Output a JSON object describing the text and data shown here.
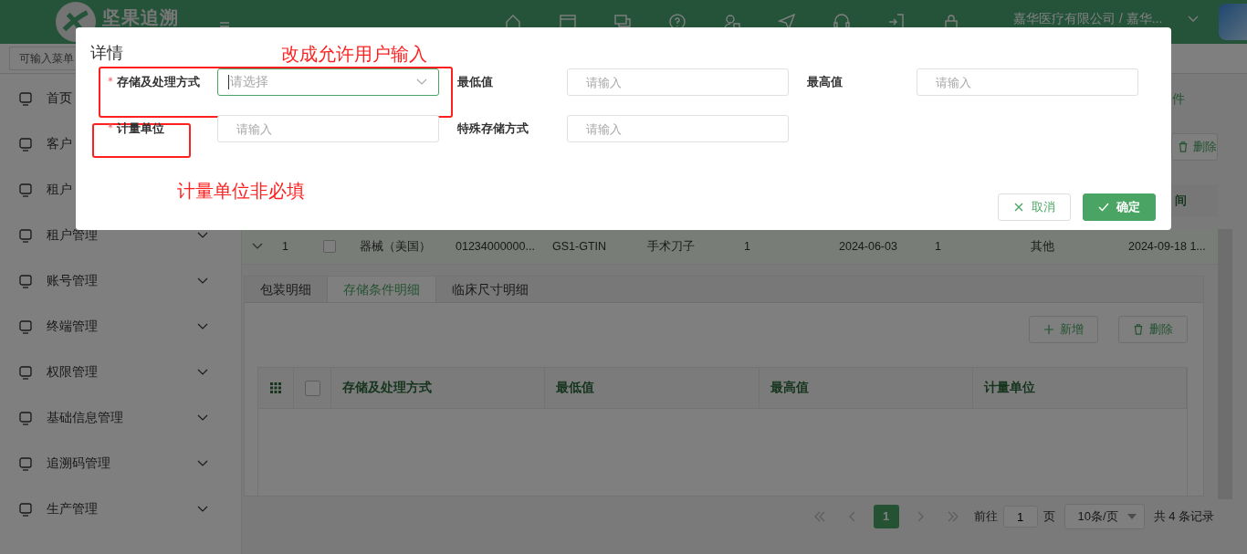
{
  "header": {
    "logo_text": "坚果追溯",
    "company": "嘉华医疗有限公司 / 嘉华..."
  },
  "menu_search": {
    "placeholder": "可输入菜单"
  },
  "sidebar": {
    "items": [
      {
        "label": "首页"
      },
      {
        "label": "客户"
      },
      {
        "label": "租户"
      },
      {
        "label": "租户管理"
      },
      {
        "label": "账号管理"
      },
      {
        "label": "终端管理"
      },
      {
        "label": "权限管理"
      },
      {
        "label": "基础信息管理"
      },
      {
        "label": "追溯码管理"
      },
      {
        "label": "生产管理"
      }
    ]
  },
  "main": {
    "top_text": "件",
    "delete_button": "删除",
    "column_header": "间",
    "row": {
      "expanded": true,
      "checked": false,
      "cells": [
        "1",
        "器械（美国）",
        "01234000000...",
        "GS1-GTIN",
        "手术刀子",
        "1",
        "2024-06-03",
        "1",
        "其他",
        "2024-09-18 1..."
      ]
    },
    "detail_tabs": [
      {
        "label": "包装明细",
        "selected": false
      },
      {
        "label": "存储条件明细",
        "selected": true
      },
      {
        "label": "临床尺寸明细",
        "selected": false
      }
    ],
    "actions": [
      {
        "kind": "add",
        "label": "新增"
      },
      {
        "kind": "delete",
        "label": "删除"
      }
    ],
    "table": {
      "columns": [
        "存储及处理方式",
        "最低值",
        "最高值",
        "计量单位"
      ],
      "all_checked": false
    },
    "pagination": {
      "pages": [
        {
          "label": "1",
          "selected": true
        }
      ],
      "goto_label": "前往",
      "goto_value": "1",
      "page_unit": "页",
      "page_size": "10条/页",
      "total": "共 4 条记录"
    }
  },
  "dialog": {
    "title": "详情",
    "rows": [
      [
        {
          "label": "存储及处理方式",
          "required": true,
          "kind": "select",
          "placeholder": "请选择",
          "focused": true
        },
        {
          "label": "最低值",
          "required": false,
          "kind": "input",
          "placeholder": "请输入",
          "focused": false
        },
        {
          "label": "最高值",
          "required": false,
          "kind": "input",
          "placeholder": "请输入",
          "focused": false
        }
      ],
      [
        {
          "label": "计量单位",
          "required": true,
          "kind": "input",
          "placeholder": "请输入",
          "focused": false
        },
        {
          "label": "特殊存储方式",
          "required": false,
          "kind": "input",
          "placeholder": "请输入",
          "focused": false
        }
      ]
    ],
    "cancel": "取消",
    "confirm": "确定"
  },
  "annotations": [
    {
      "kind": "note",
      "text": "改成允许用户输入"
    },
    {
      "kind": "note",
      "text": "计量单位非必填"
    }
  ]
}
